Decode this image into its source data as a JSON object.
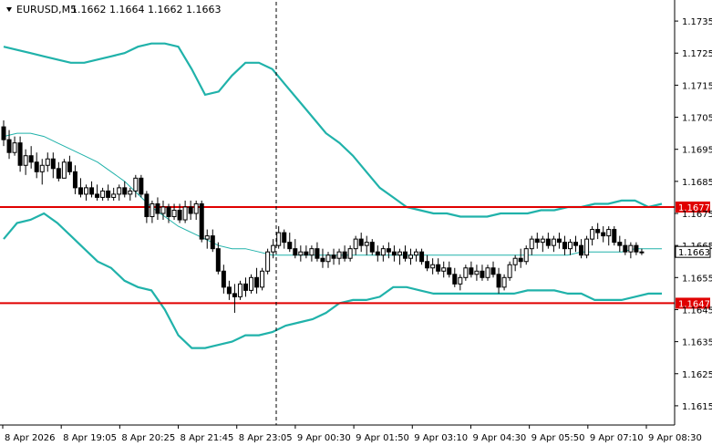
{
  "header": {
    "symbol": "EURUSD,M5",
    "ohlc": "1.1662 1.1664 1.1662 1.1663"
  },
  "colors": {
    "background": "#ffffff",
    "candle": "#000000",
    "bollinger_band": "#20b2aa",
    "level_line": "#e00000",
    "vertical_marker": "#000000"
  },
  "chart_data": {
    "type": "candlestick",
    "title": "EURUSD,M5",
    "y_axis": {
      "position": "right",
      "ylim": [
        1.1609,
        1.1741
      ],
      "ticks": [
        "1.1735",
        "1.1725",
        "1.1715",
        "1.1705",
        "1.1695",
        "1.1685",
        "1.1675",
        "1.1665",
        "1.1655",
        "1.1645",
        "1.1635",
        "1.1625",
        "1.1615"
      ]
    },
    "x_axis": {
      "tick_labels": [
        "8 Apr 2026",
        "8 Apr 19:05",
        "8 Apr 20:25",
        "8 Apr 21:45",
        "8 Apr 23:05",
        "9 Apr 00:30",
        "9 Apr 01:50",
        "9 Apr 03:10",
        "9 Apr 04:30",
        "9 Apr 05:50",
        "9 Apr 07:10",
        "9 Apr 08:30"
      ],
      "bar_count": 119
    },
    "horizontal_levels": [
      {
        "value": 1.1677,
        "label": "1.1677",
        "color": "#e00000"
      },
      {
        "value": 1.1647,
        "label": "1.1647",
        "color": "#e00000"
      }
    ],
    "current_price": {
      "value": 1.1663,
      "label": "1.1663"
    },
    "vertical_marker_bar": 49,
    "bollinger": {
      "upper": [
        1.1727,
        1.1726,
        1.1725,
        1.1724,
        1.1723,
        1.1722,
        1.1722,
        1.1723,
        1.1724,
        1.1725,
        1.1727,
        1.1728,
        1.1728,
        1.1727,
        1.172,
        1.1712,
        1.1713,
        1.1718,
        1.1722,
        1.1722,
        1.172,
        1.1715,
        1.171,
        1.1705,
        1.17,
        1.1697,
        1.1693,
        1.1688,
        1.1683,
        1.168,
        1.1677,
        1.1676,
        1.1675,
        1.1675,
        1.1674,
        1.1674,
        1.1674,
        1.1675,
        1.1675,
        1.1675,
        1.1676,
        1.1676,
        1.1677,
        1.1677,
        1.1678,
        1.1678,
        1.1679,
        1.1679,
        1.1677,
        1.1678
      ],
      "middle": [
        1.1699,
        1.17,
        1.17,
        1.1699,
        1.1697,
        1.1695,
        1.1693,
        1.1691,
        1.1688,
        1.1685,
        1.1681,
        1.1677,
        1.1674,
        1.1671,
        1.1669,
        1.1667,
        1.1665,
        1.1664,
        1.1664,
        1.1663,
        1.1662,
        1.1662,
        1.1662,
        1.1662,
        1.1662,
        1.1662,
        1.1662,
        1.1662,
        1.1662,
        1.1662,
        1.1662,
        1.1662,
        1.1662,
        1.1662,
        1.1662,
        1.1662,
        1.1662,
        1.1662,
        1.1662,
        1.1662,
        1.1662,
        1.1662,
        1.1662,
        1.1663,
        1.1663,
        1.1663,
        1.1663,
        1.1664,
        1.1664,
        1.1664
      ],
      "lower": [
        1.1667,
        1.1672,
        1.1673,
        1.1675,
        1.1672,
        1.1668,
        1.1664,
        1.166,
        1.1658,
        1.1654,
        1.1652,
        1.1651,
        1.1645,
        1.1637,
        1.1633,
        1.1633,
        1.1634,
        1.1635,
        1.1637,
        1.1637,
        1.1638,
        1.164,
        1.1641,
        1.1642,
        1.1644,
        1.1647,
        1.1648,
        1.1648,
        1.1649,
        1.1652,
        1.1652,
        1.1651,
        1.165,
        1.165,
        1.165,
        1.165,
        1.165,
        1.165,
        1.165,
        1.1651,
        1.1651,
        1.1651,
        1.165,
        1.165,
        1.1648,
        1.1648,
        1.1648,
        1.1649,
        1.165,
        1.165
      ]
    },
    "candles": [
      [
        1.1702,
        1.1704,
        1.1696,
        1.1698
      ],
      [
        1.1698,
        1.1701,
        1.1692,
        1.1694
      ],
      [
        1.1694,
        1.1699,
        1.1693,
        1.1697
      ],
      [
        1.1697,
        1.1699,
        1.1688,
        1.169
      ],
      [
        1.169,
        1.1695,
        1.1687,
        1.1693
      ],
      [
        1.1693,
        1.1696,
        1.1689,
        1.1691
      ],
      [
        1.1691,
        1.1694,
        1.1686,
        1.1688
      ],
      [
        1.1688,
        1.1692,
        1.1684,
        1.169
      ],
      [
        1.169,
        1.1694,
        1.1688,
        1.1692
      ],
      [
        1.1692,
        1.1694,
        1.1686,
        1.1689
      ],
      [
        1.1689,
        1.1691,
        1.1685,
        1.1686
      ],
      [
        1.1686,
        1.1692,
        1.1686,
        1.1691
      ],
      [
        1.1691,
        1.1693,
        1.1687,
        1.1688
      ],
      [
        1.1688,
        1.169,
        1.1681,
        1.1683
      ],
      [
        1.1683,
        1.1686,
        1.168,
        1.1681
      ],
      [
        1.1681,
        1.1684,
        1.1679,
        1.1683
      ],
      [
        1.1683,
        1.1685,
        1.168,
        1.1681
      ],
      [
        1.1681,
        1.1684,
        1.1679,
        1.168
      ],
      [
        1.168,
        1.1683,
        1.1679,
        1.1682
      ],
      [
        1.1682,
        1.1684,
        1.1679,
        1.168
      ],
      [
        1.168,
        1.1683,
        1.1679,
        1.1681
      ],
      [
        1.1681,
        1.1684,
        1.1679,
        1.1683
      ],
      [
        1.1683,
        1.1685,
        1.168,
        1.1681
      ],
      [
        1.1681,
        1.1683,
        1.1679,
        1.1682
      ],
      [
        1.1682,
        1.1687,
        1.168,
        1.1686
      ],
      [
        1.1686,
        1.1687,
        1.168,
        1.1681
      ],
      [
        1.1681,
        1.1682,
        1.1672,
        1.1674
      ],
      [
        1.1674,
        1.1679,
        1.1672,
        1.1678
      ],
      [
        1.1678,
        1.168,
        1.1673,
        1.1675
      ],
      [
        1.1675,
        1.1679,
        1.1673,
        1.1677
      ],
      [
        1.1677,
        1.1678,
        1.1672,
        1.1674
      ],
      [
        1.1674,
        1.1678,
        1.1673,
        1.1676
      ],
      [
        1.1676,
        1.1678,
        1.1672,
        1.1673
      ],
      [
        1.1673,
        1.1679,
        1.1672,
        1.1677
      ],
      [
        1.1677,
        1.1679,
        1.1673,
        1.1675
      ],
      [
        1.1675,
        1.1679,
        1.1673,
        1.1678
      ],
      [
        1.1678,
        1.1679,
        1.1666,
        1.1667
      ],
      [
        1.1667,
        1.167,
        1.1664,
        1.1668
      ],
      [
        1.1668,
        1.167,
        1.1663,
        1.1664
      ],
      [
        1.1664,
        1.1666,
        1.1656,
        1.1657
      ],
      [
        1.1657,
        1.1659,
        1.165,
        1.1652
      ],
      [
        1.1652,
        1.1654,
        1.1648,
        1.165
      ],
      [
        1.165,
        1.1653,
        1.1644,
        1.1649
      ],
      [
        1.1649,
        1.1654,
        1.1648,
        1.1653
      ],
      [
        1.1653,
        1.1655,
        1.1649,
        1.1651
      ],
      [
        1.1651,
        1.1656,
        1.165,
        1.1655
      ],
      [
        1.1655,
        1.1658,
        1.165,
        1.1652
      ],
      [
        1.1652,
        1.1658,
        1.1651,
        1.1657
      ],
      [
        1.1657,
        1.1664,
        1.1656,
        1.1663
      ],
      [
        1.1663,
        1.1667,
        1.1661,
        1.1665
      ],
      [
        1.1665,
        1.1671,
        1.1664,
        1.1669
      ],
      [
        1.1669,
        1.167,
        1.1664,
        1.1666
      ],
      [
        1.1666,
        1.1669,
        1.1663,
        1.1664
      ],
      [
        1.1664,
        1.1667,
        1.1661,
        1.1662
      ],
      [
        1.1662,
        1.1665,
        1.166,
        1.1663
      ],
      [
        1.1663,
        1.1665,
        1.1661,
        1.1662
      ],
      [
        1.1662,
        1.1665,
        1.166,
        1.1664
      ],
      [
        1.1664,
        1.1666,
        1.166,
        1.1661
      ],
      [
        1.1661,
        1.1664,
        1.1658,
        1.166
      ],
      [
        1.166,
        1.1663,
        1.1658,
        1.1662
      ],
      [
        1.1662,
        1.1664,
        1.1659,
        1.1661
      ],
      [
        1.1661,
        1.1664,
        1.1659,
        1.1663
      ],
      [
        1.1663,
        1.1665,
        1.166,
        1.1661
      ],
      [
        1.1661,
        1.1665,
        1.166,
        1.1664
      ],
      [
        1.1664,
        1.1668,
        1.1662,
        1.1667
      ],
      [
        1.1667,
        1.1669,
        1.1663,
        1.1665
      ],
      [
        1.1665,
        1.1668,
        1.1662,
        1.1666
      ],
      [
        1.1666,
        1.1667,
        1.1662,
        1.1663
      ],
      [
        1.1663,
        1.1665,
        1.166,
        1.1662
      ],
      [
        1.1662,
        1.1665,
        1.166,
        1.1664
      ],
      [
        1.1664,
        1.1666,
        1.1661,
        1.1663
      ],
      [
        1.1663,
        1.1665,
        1.166,
        1.1662
      ],
      [
        1.1662,
        1.1664,
        1.1659,
        1.1663
      ],
      [
        1.1663,
        1.1665,
        1.166,
        1.1661
      ],
      [
        1.1661,
        1.1664,
        1.1659,
        1.1662
      ],
      [
        1.1662,
        1.1664,
        1.166,
        1.1663
      ],
      [
        1.1663,
        1.1664,
        1.1659,
        1.166
      ],
      [
        1.166,
        1.1662,
        1.1657,
        1.1658
      ],
      [
        1.1658,
        1.1661,
        1.1656,
        1.1659
      ],
      [
        1.1659,
        1.1661,
        1.1656,
        1.1657
      ],
      [
        1.1657,
        1.166,
        1.1655,
        1.1658
      ],
      [
        1.1658,
        1.166,
        1.1655,
        1.1656
      ],
      [
        1.1656,
        1.1658,
        1.1652,
        1.1653
      ],
      [
        1.1653,
        1.1656,
        1.1651,
        1.1655
      ],
      [
        1.1655,
        1.1659,
        1.1654,
        1.1658
      ],
      [
        1.1658,
        1.166,
        1.1655,
        1.1656
      ],
      [
        1.1656,
        1.1659,
        1.1654,
        1.1657
      ],
      [
        1.1657,
        1.1659,
        1.1654,
        1.1655
      ],
      [
        1.1655,
        1.1659,
        1.1654,
        1.1658
      ],
      [
        1.1658,
        1.166,
        1.1655,
        1.1656
      ],
      [
        1.1656,
        1.1658,
        1.165,
        1.1652
      ],
      [
        1.1652,
        1.1656,
        1.1651,
        1.1655
      ],
      [
        1.1655,
        1.166,
        1.1654,
        1.1659
      ],
      [
        1.1659,
        1.1662,
        1.1657,
        1.1661
      ],
      [
        1.1661,
        1.1664,
        1.1658,
        1.166
      ],
      [
        1.166,
        1.1665,
        1.1659,
        1.1664
      ],
      [
        1.1664,
        1.1668,
        1.1662,
        1.1667
      ],
      [
        1.1667,
        1.1669,
        1.1664,
        1.1666
      ],
      [
        1.1666,
        1.1668,
        1.1663,
        1.1667
      ],
      [
        1.1667,
        1.1669,
        1.1664,
        1.1665
      ],
      [
        1.1665,
        1.1668,
        1.1663,
        1.1667
      ],
      [
        1.1667,
        1.1669,
        1.1664,
        1.1666
      ],
      [
        1.1666,
        1.1668,
        1.1662,
        1.1664
      ],
      [
        1.1664,
        1.1667,
        1.1662,
        1.1666
      ],
      [
        1.1666,
        1.1668,
        1.1663,
        1.1665
      ],
      [
        1.1665,
        1.1667,
        1.1661,
        1.1662
      ],
      [
        1.1662,
        1.1668,
        1.1661,
        1.1667
      ],
      [
        1.1667,
        1.1671,
        1.1665,
        1.167
      ],
      [
        1.167,
        1.1672,
        1.1667,
        1.1669
      ],
      [
        1.1669,
        1.1671,
        1.1666,
        1.1668
      ],
      [
        1.1668,
        1.1671,
        1.1665,
        1.167
      ],
      [
        1.167,
        1.1671,
        1.1665,
        1.1666
      ],
      [
        1.1666,
        1.1668,
        1.1663,
        1.1665
      ],
      [
        1.1665,
        1.1667,
        1.1662,
        1.1663
      ],
      [
        1.1663,
        1.1666,
        1.1661,
        1.1665
      ],
      [
        1.1665,
        1.1666,
        1.1662,
        1.1663
      ],
      [
        1.1663,
        1.1664,
        1.1662,
        1.1663
      ]
    ]
  }
}
